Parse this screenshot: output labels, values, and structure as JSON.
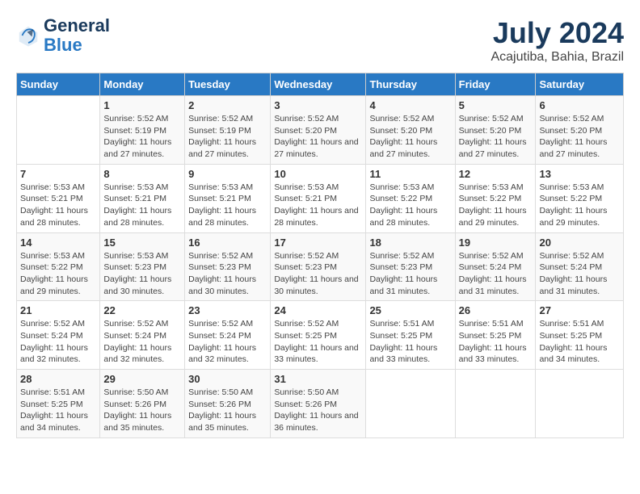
{
  "logo": {
    "line1": "General",
    "line2": "Blue"
  },
  "title": "July 2024",
  "subtitle": "Acajutiba, Bahia, Brazil",
  "days_of_week": [
    "Sunday",
    "Monday",
    "Tuesday",
    "Wednesday",
    "Thursday",
    "Friday",
    "Saturday"
  ],
  "weeks": [
    [
      {
        "day": "",
        "sunrise": "",
        "sunset": "",
        "daylight": ""
      },
      {
        "day": "1",
        "sunrise": "Sunrise: 5:52 AM",
        "sunset": "Sunset: 5:19 PM",
        "daylight": "Daylight: 11 hours and 27 minutes."
      },
      {
        "day": "2",
        "sunrise": "Sunrise: 5:52 AM",
        "sunset": "Sunset: 5:19 PM",
        "daylight": "Daylight: 11 hours and 27 minutes."
      },
      {
        "day": "3",
        "sunrise": "Sunrise: 5:52 AM",
        "sunset": "Sunset: 5:20 PM",
        "daylight": "Daylight: 11 hours and 27 minutes."
      },
      {
        "day": "4",
        "sunrise": "Sunrise: 5:52 AM",
        "sunset": "Sunset: 5:20 PM",
        "daylight": "Daylight: 11 hours and 27 minutes."
      },
      {
        "day": "5",
        "sunrise": "Sunrise: 5:52 AM",
        "sunset": "Sunset: 5:20 PM",
        "daylight": "Daylight: 11 hours and 27 minutes."
      },
      {
        "day": "6",
        "sunrise": "Sunrise: 5:52 AM",
        "sunset": "Sunset: 5:20 PM",
        "daylight": "Daylight: 11 hours and 27 minutes."
      }
    ],
    [
      {
        "day": "7",
        "sunrise": "Sunrise: 5:53 AM",
        "sunset": "Sunset: 5:21 PM",
        "daylight": "Daylight: 11 hours and 28 minutes."
      },
      {
        "day": "8",
        "sunrise": "Sunrise: 5:53 AM",
        "sunset": "Sunset: 5:21 PM",
        "daylight": "Daylight: 11 hours and 28 minutes."
      },
      {
        "day": "9",
        "sunrise": "Sunrise: 5:53 AM",
        "sunset": "Sunset: 5:21 PM",
        "daylight": "Daylight: 11 hours and 28 minutes."
      },
      {
        "day": "10",
        "sunrise": "Sunrise: 5:53 AM",
        "sunset": "Sunset: 5:21 PM",
        "daylight": "Daylight: 11 hours and 28 minutes."
      },
      {
        "day": "11",
        "sunrise": "Sunrise: 5:53 AM",
        "sunset": "Sunset: 5:22 PM",
        "daylight": "Daylight: 11 hours and 28 minutes."
      },
      {
        "day": "12",
        "sunrise": "Sunrise: 5:53 AM",
        "sunset": "Sunset: 5:22 PM",
        "daylight": "Daylight: 11 hours and 29 minutes."
      },
      {
        "day": "13",
        "sunrise": "Sunrise: 5:53 AM",
        "sunset": "Sunset: 5:22 PM",
        "daylight": "Daylight: 11 hours and 29 minutes."
      }
    ],
    [
      {
        "day": "14",
        "sunrise": "Sunrise: 5:53 AM",
        "sunset": "Sunset: 5:22 PM",
        "daylight": "Daylight: 11 hours and 29 minutes."
      },
      {
        "day": "15",
        "sunrise": "Sunrise: 5:53 AM",
        "sunset": "Sunset: 5:23 PM",
        "daylight": "Daylight: 11 hours and 30 minutes."
      },
      {
        "day": "16",
        "sunrise": "Sunrise: 5:52 AM",
        "sunset": "Sunset: 5:23 PM",
        "daylight": "Daylight: 11 hours and 30 minutes."
      },
      {
        "day": "17",
        "sunrise": "Sunrise: 5:52 AM",
        "sunset": "Sunset: 5:23 PM",
        "daylight": "Daylight: 11 hours and 30 minutes."
      },
      {
        "day": "18",
        "sunrise": "Sunrise: 5:52 AM",
        "sunset": "Sunset: 5:23 PM",
        "daylight": "Daylight: 11 hours and 31 minutes."
      },
      {
        "day": "19",
        "sunrise": "Sunrise: 5:52 AM",
        "sunset": "Sunset: 5:24 PM",
        "daylight": "Daylight: 11 hours and 31 minutes."
      },
      {
        "day": "20",
        "sunrise": "Sunrise: 5:52 AM",
        "sunset": "Sunset: 5:24 PM",
        "daylight": "Daylight: 11 hours and 31 minutes."
      }
    ],
    [
      {
        "day": "21",
        "sunrise": "Sunrise: 5:52 AM",
        "sunset": "Sunset: 5:24 PM",
        "daylight": "Daylight: 11 hours and 32 minutes."
      },
      {
        "day": "22",
        "sunrise": "Sunrise: 5:52 AM",
        "sunset": "Sunset: 5:24 PM",
        "daylight": "Daylight: 11 hours and 32 minutes."
      },
      {
        "day": "23",
        "sunrise": "Sunrise: 5:52 AM",
        "sunset": "Sunset: 5:24 PM",
        "daylight": "Daylight: 11 hours and 32 minutes."
      },
      {
        "day": "24",
        "sunrise": "Sunrise: 5:52 AM",
        "sunset": "Sunset: 5:25 PM",
        "daylight": "Daylight: 11 hours and 33 minutes."
      },
      {
        "day": "25",
        "sunrise": "Sunrise: 5:51 AM",
        "sunset": "Sunset: 5:25 PM",
        "daylight": "Daylight: 11 hours and 33 minutes."
      },
      {
        "day": "26",
        "sunrise": "Sunrise: 5:51 AM",
        "sunset": "Sunset: 5:25 PM",
        "daylight": "Daylight: 11 hours and 33 minutes."
      },
      {
        "day": "27",
        "sunrise": "Sunrise: 5:51 AM",
        "sunset": "Sunset: 5:25 PM",
        "daylight": "Daylight: 11 hours and 34 minutes."
      }
    ],
    [
      {
        "day": "28",
        "sunrise": "Sunrise: 5:51 AM",
        "sunset": "Sunset: 5:25 PM",
        "daylight": "Daylight: 11 hours and 34 minutes."
      },
      {
        "day": "29",
        "sunrise": "Sunrise: 5:50 AM",
        "sunset": "Sunset: 5:26 PM",
        "daylight": "Daylight: 11 hours and 35 minutes."
      },
      {
        "day": "30",
        "sunrise": "Sunrise: 5:50 AM",
        "sunset": "Sunset: 5:26 PM",
        "daylight": "Daylight: 11 hours and 35 minutes."
      },
      {
        "day": "31",
        "sunrise": "Sunrise: 5:50 AM",
        "sunset": "Sunset: 5:26 PM",
        "daylight": "Daylight: 11 hours and 36 minutes."
      },
      {
        "day": "",
        "sunrise": "",
        "sunset": "",
        "daylight": ""
      },
      {
        "day": "",
        "sunrise": "",
        "sunset": "",
        "daylight": ""
      },
      {
        "day": "",
        "sunrise": "",
        "sunset": "",
        "daylight": ""
      }
    ]
  ]
}
